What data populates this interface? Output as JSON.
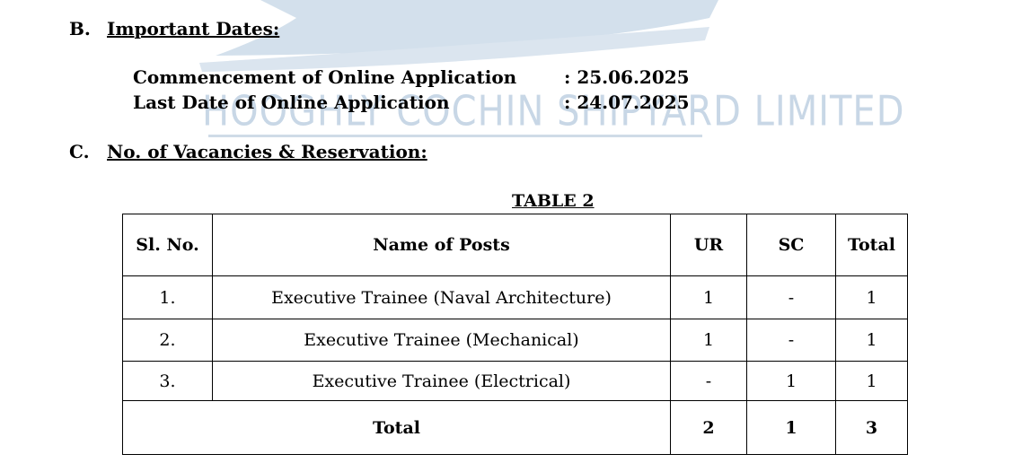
{
  "watermark": {
    "text": "HOOGHLY COCHIN SHIPYARD LIMITED"
  },
  "section_b": {
    "letter": "B.",
    "title": "Important Dates:",
    "dates": [
      {
        "label": "Commencement of Online Application",
        "value": ": 25.06.2025"
      },
      {
        "label": "Last Date of Online Application",
        "value": ": 24.07.2025"
      }
    ]
  },
  "section_c": {
    "letter": "C.",
    "title": "No. of Vacancies & Reservation:"
  },
  "table": {
    "caption": "TABLE 2",
    "headers": [
      "Sl. No.",
      "Name of Posts",
      "UR",
      "SC",
      "Total"
    ],
    "rows": [
      [
        "1.",
        "Executive Trainee (Naval Architecture)",
        "1",
        "-",
        "1"
      ],
      [
        "2.",
        "Executive Trainee (Mechanical)",
        "1",
        "-",
        "1"
      ],
      [
        "3.",
        "Executive Trainee (Electrical)",
        "-",
        "1",
        "1"
      ]
    ],
    "total_row": [
      "Total",
      "2",
      "1",
      "3"
    ]
  },
  "colors": {
    "watermark": "#c8d7e6",
    "watermark_yellow": "#fdf3b8"
  }
}
